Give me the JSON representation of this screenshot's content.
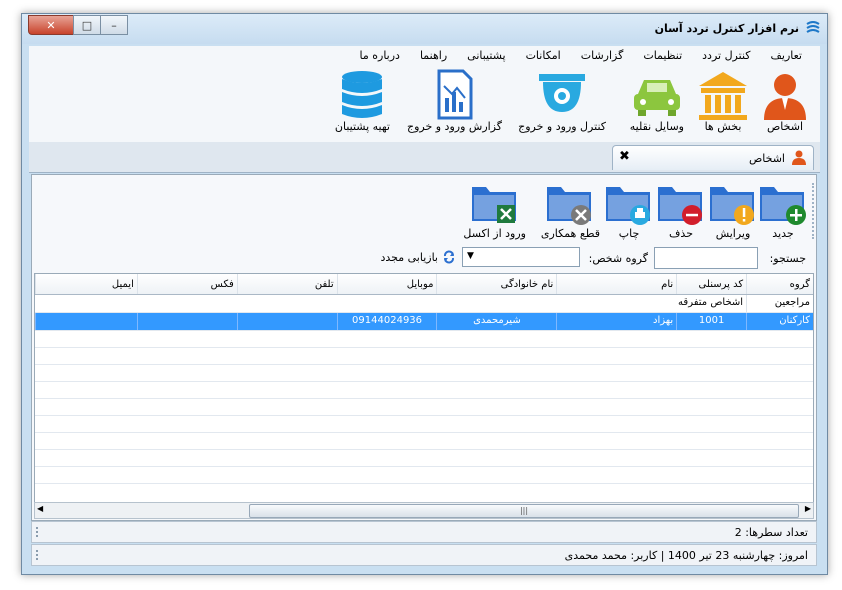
{
  "window": {
    "title": "نرم افزار کنترل تردد آسان",
    "colors": {
      "frame": "#c9dff1",
      "selection": "#3399ff",
      "close": "#c8432b"
    }
  },
  "menu": [
    "تعاریف",
    "کنترل تردد",
    "تنظیمات",
    "گزارشات",
    "امکانات",
    "پشتیبانی",
    "راهنما",
    "درباره ما"
  ],
  "ribbon": [
    {
      "label": "اشخاص",
      "icon": "person-icon"
    },
    {
      "label": "بخش ها",
      "icon": "building-icon"
    },
    {
      "label": "وسایل نقلیه",
      "icon": "car-icon"
    },
    {
      "label": "کنترل ورود و خروج",
      "icon": "camera-icon"
    },
    {
      "label": "گزارش ورود و خروج",
      "icon": "report-icon"
    },
    {
      "label": "تهیه پشتیبان",
      "icon": "database-icon"
    }
  ],
  "tab": {
    "label": "اشخاص",
    "close": "✖"
  },
  "toolbar": [
    {
      "label": "جدید",
      "badge": "plus"
    },
    {
      "label": "ویرایش",
      "badge": "exclamation"
    },
    {
      "label": "حذف",
      "badge": "minus"
    },
    {
      "label": "چاپ",
      "badge": "printer"
    },
    {
      "label": "قطع همکاری",
      "badge": "cross"
    },
    {
      "label": "ورود از اکسل",
      "badge": "excel"
    }
  ],
  "search": {
    "label": "جستجو:",
    "value": "",
    "group_label": "گروه شخص:",
    "group_value": "",
    "refresh_label": "بازیابی مجدد"
  },
  "grid": {
    "columns": [
      "گروه",
      "کد پرسنلی",
      "نام",
      "نام خانوادگی",
      "موبایل",
      "تلفن",
      "فکس",
      "ایمیل"
    ],
    "rows": [
      {
        "cells": [
          "مراجعین",
          "",
          "",
          "",
          "",
          "",
          "",
          ""
        ],
        "selected": false,
        "group_header": true,
        "group_title": "اشخاص متفرقه"
      },
      {
        "cells": [
          "کارکنان",
          "1001",
          "بهزاد",
          "شیرمحمدی",
          "09144024936",
          "",
          "",
          ""
        ],
        "selected": true
      }
    ]
  },
  "footer": {
    "row_count": "تعداد سطرها:  2",
    "status": "امروز: چهارشنبه 23 تیر 1400   |   کاربر: محمد محمدی"
  }
}
